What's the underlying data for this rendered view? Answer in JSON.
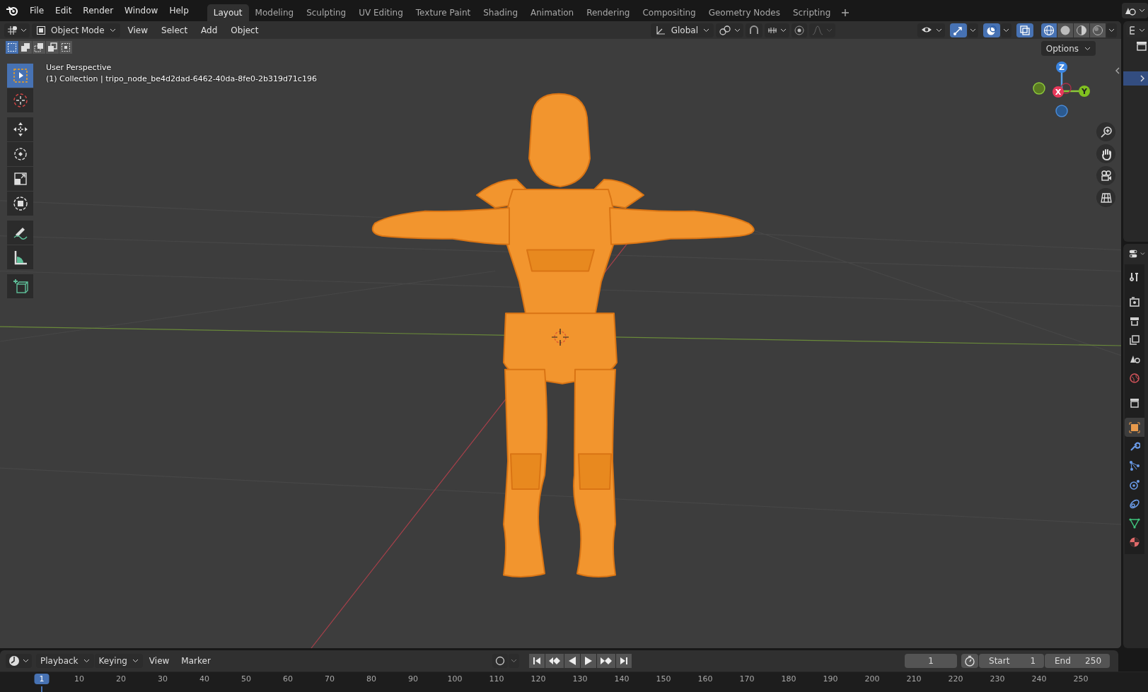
{
  "top_bar": {
    "menus": [
      "File",
      "Edit",
      "Render",
      "Window",
      "Help"
    ],
    "workspaces": [
      {
        "label": "Layout",
        "selected": true
      },
      {
        "label": "Modeling",
        "selected": false
      },
      {
        "label": "Sculpting",
        "selected": false
      },
      {
        "label": "UV Editing",
        "selected": false
      },
      {
        "label": "Texture Paint",
        "selected": false
      },
      {
        "label": "Shading",
        "selected": false
      },
      {
        "label": "Animation",
        "selected": false
      },
      {
        "label": "Rendering",
        "selected": false
      },
      {
        "label": "Compositing",
        "selected": false
      },
      {
        "label": "Geometry Nodes",
        "selected": false
      },
      {
        "label": "Scripting",
        "selected": false
      }
    ]
  },
  "viewport_header": {
    "mode": "Object Mode",
    "menus": [
      "View",
      "Select",
      "Add",
      "Object"
    ],
    "orientation": "Global",
    "toggles": [
      {
        "kind": "gizmo",
        "on": true
      },
      {
        "kind": "overlay",
        "on": true
      },
      {
        "kind": "xray",
        "on": true
      }
    ],
    "shading": [
      {
        "kind": "wireframe",
        "selected": true
      },
      {
        "kind": "solid",
        "selected": false
      },
      {
        "kind": "material",
        "selected": false
      },
      {
        "kind": "rendered",
        "selected": false
      }
    ],
    "select_modes": [
      {
        "kind": "new",
        "selected": true
      },
      {
        "kind": "extend",
        "selected": false
      },
      {
        "kind": "subtract",
        "selected": false
      },
      {
        "kind": "invert",
        "selected": false
      },
      {
        "kind": "intersect",
        "selected": false
      }
    ],
    "options": "Options"
  },
  "viewport": {
    "view_name": "User Perspective",
    "object_line": "(1) Collection | tripo_node_be4d2dad-6462-40da-8fe0-2b319d71c196",
    "tools": [
      {
        "kind": "select_box",
        "selected": true
      },
      {
        "kind": "cursor",
        "selected": false
      },
      {
        "kind": "move",
        "selected": false
      },
      {
        "kind": "rotate",
        "selected": false
      },
      {
        "kind": "scale",
        "selected": false
      },
      {
        "kind": "transform",
        "selected": false
      },
      {
        "kind": "annotate",
        "selected": false
      },
      {
        "kind": "measure",
        "selected": false
      },
      {
        "kind": "add_cube",
        "selected": false
      }
    ],
    "gizmo_axes": [
      "Z",
      "X",
      "Y"
    ]
  },
  "properties_tabs": [
    {
      "kind": "tool",
      "selected": false
    },
    {
      "kind": "render",
      "selected": false
    },
    {
      "kind": "output",
      "selected": false
    },
    {
      "kind": "view_layer",
      "selected": false
    },
    {
      "kind": "scene",
      "selected": false
    },
    {
      "kind": "world",
      "selected": false
    },
    {
      "kind": "collection",
      "selected": false
    },
    {
      "kind": "object",
      "selected": true
    },
    {
      "kind": "modifiers",
      "selected": false
    },
    {
      "kind": "particles",
      "selected": false
    },
    {
      "kind": "physics",
      "selected": false
    },
    {
      "kind": "constraints",
      "selected": false
    },
    {
      "kind": "data",
      "selected": false
    },
    {
      "kind": "material",
      "selected": false
    }
  ],
  "timeline": {
    "menus": [
      {
        "label": "Playback",
        "kind": "dropdown"
      },
      {
        "label": "Keying",
        "kind": "dropdown"
      },
      {
        "label": "View",
        "kind": "menu"
      },
      {
        "label": "Marker",
        "kind": "menu"
      }
    ],
    "current_frame": "1",
    "start_label": "Start",
    "start": "1",
    "end_label": "End",
    "end": "250",
    "ruler": [
      {
        "label": "1",
        "selected": true
      },
      {
        "label": "10",
        "selected": false
      },
      {
        "label": "20",
        "selected": false
      },
      {
        "label": "30",
        "selected": false
      },
      {
        "label": "40",
        "selected": false
      },
      {
        "label": "50",
        "selected": false
      },
      {
        "label": "60",
        "selected": false
      },
      {
        "label": "70",
        "selected": false
      },
      {
        "label": "80",
        "selected": false
      },
      {
        "label": "90",
        "selected": false
      },
      {
        "label": "100",
        "selected": false
      },
      {
        "label": "110",
        "selected": false
      },
      {
        "label": "120",
        "selected": false
      },
      {
        "label": "130",
        "selected": false
      },
      {
        "label": "140",
        "selected": false
      },
      {
        "label": "150",
        "selected": false
      },
      {
        "label": "160",
        "selected": false
      },
      {
        "label": "170",
        "selected": false
      },
      {
        "label": "180",
        "selected": false
      },
      {
        "label": "190",
        "selected": false
      },
      {
        "label": "200",
        "selected": false
      },
      {
        "label": "210",
        "selected": false
      },
      {
        "label": "220",
        "selected": false
      },
      {
        "label": "230",
        "selected": false
      },
      {
        "label": "240",
        "selected": false
      },
      {
        "label": "250",
        "selected": false
      }
    ]
  }
}
